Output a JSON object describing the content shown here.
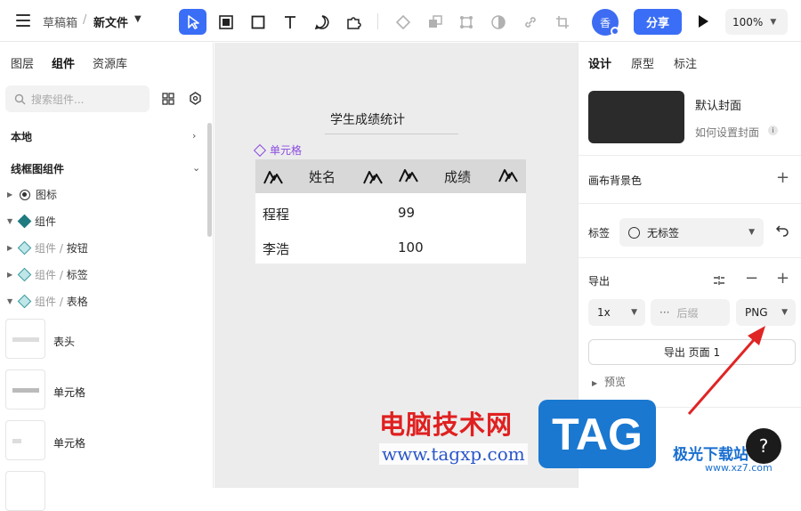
{
  "topbar": {
    "drafts": "草稿箱",
    "separator": "/",
    "file_name": "新文件",
    "avatar_text": "香",
    "share_label": "分享",
    "zoom": "100%"
  },
  "left_panel": {
    "tabs": [
      "图层",
      "组件",
      "资源库"
    ],
    "active_tab": "组件",
    "search_placeholder": "搜索组件...",
    "section_local": "本地",
    "section_wireframe": "线框图组件",
    "tree": [
      {
        "label": "图标",
        "prefix": "",
        "icon": "target-icon"
      },
      {
        "label": "组件",
        "prefix": "",
        "icon": "component-icon"
      },
      {
        "label": "按钮",
        "prefix": "组件 / ",
        "icon": "component-icon"
      },
      {
        "label": "标签",
        "prefix": "组件 / ",
        "icon": "component-icon"
      },
      {
        "label": "表格",
        "prefix": "组件 / ",
        "icon": "component-icon"
      }
    ],
    "components": [
      "表头",
      "单元格",
      "单元格"
    ]
  },
  "canvas": {
    "frame_title": "学生成绩统计",
    "cell_label": "单元格",
    "table": {
      "headers": [
        "姓名",
        "成绩"
      ],
      "rows": [
        [
          "程程",
          "99"
        ],
        [
          "李浩",
          "100"
        ]
      ]
    }
  },
  "right_panel": {
    "tabs": [
      "设计",
      "原型",
      "标注"
    ],
    "active_tab": "设计",
    "cover_title": "默认封面",
    "cover_help": "如何设置封面",
    "canvas_bg_label": "画布背景色",
    "tag_label": "标签",
    "tag_value": "无标签",
    "export_label": "导出",
    "export_scale": "1x",
    "export_suffix_placeholder": "后缀",
    "export_format": "PNG",
    "export_button": "导出 页面 1",
    "preview_label": "预览"
  },
  "watermark": {
    "text": "电脑技术网",
    "url": "www.tagxp.com",
    "tag": "TAG",
    "site": "极光下载站",
    "site_url": "www.xz7.com"
  },
  "colors": {
    "accent": "#3b6ef6",
    "component_purple": "#8a4be0",
    "canvas_bg": "#ececec"
  }
}
